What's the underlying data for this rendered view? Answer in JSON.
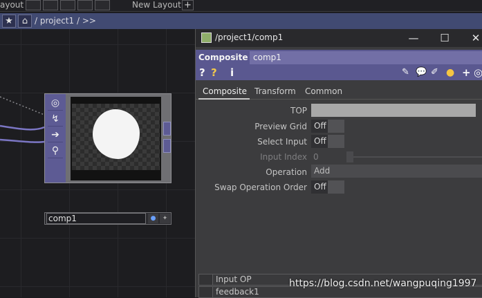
{
  "topbar": {
    "layout_label": "ayout",
    "new_layout_label": "New Layout",
    "add_label": "+"
  },
  "pathbar": {
    "path": "/ project1 / >>"
  },
  "node": {
    "name": "comp1"
  },
  "window": {
    "title": "/project1/comp1",
    "minimize": "—",
    "maximize": "☐",
    "close": "✕"
  },
  "op": {
    "type": "Composite",
    "name": "comp1"
  },
  "tabs": [
    "Composite",
    "Transform",
    "Common"
  ],
  "params": {
    "top": {
      "label": "TOP",
      "value": ""
    },
    "preview_grid": {
      "label": "Preview Grid",
      "value": "Off"
    },
    "select_input": {
      "label": "Select Input",
      "value": "Off"
    },
    "input_index": {
      "label": "Input Index",
      "value": "0"
    },
    "operation": {
      "label": "Operation",
      "value": "Add"
    },
    "swap_order": {
      "label": "Swap Operation Order",
      "value": "Off"
    }
  },
  "table": {
    "header": "Input OP",
    "rows": [
      "feedback1"
    ]
  },
  "watermark": "https://blog.csdn.net/wangpuqing1997",
  "colors": {
    "node_purple": "#5d5b94",
    "opbar": "#5a5890",
    "pathbar": "#414a72"
  }
}
